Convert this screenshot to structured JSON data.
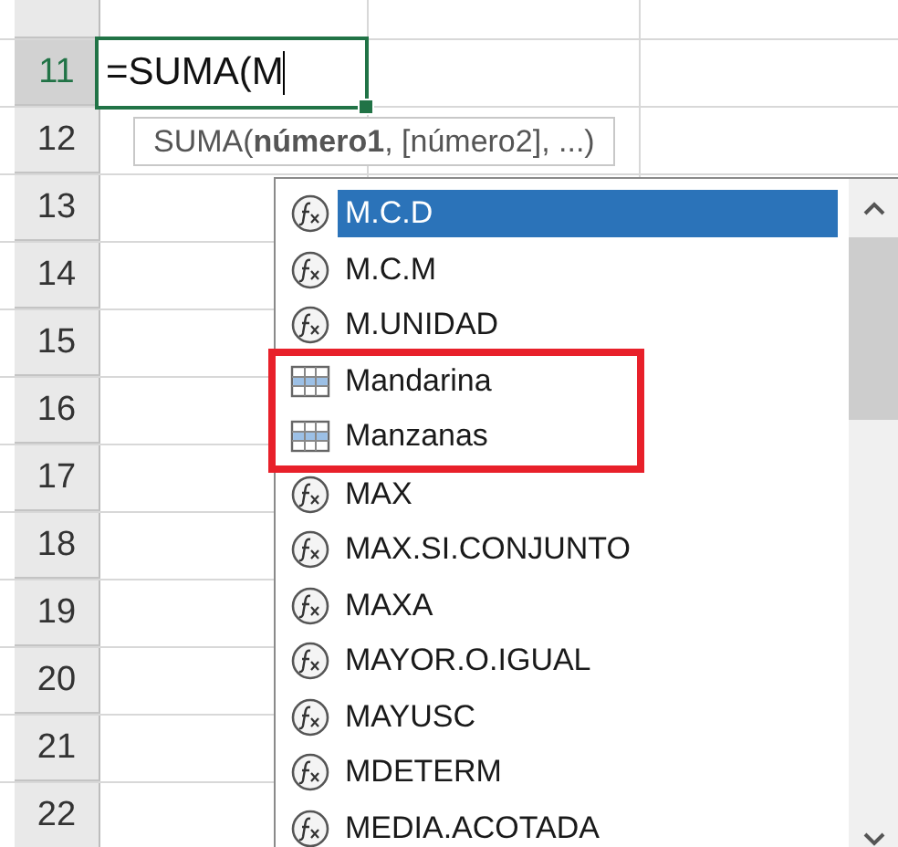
{
  "rows": [
    {
      "number": "11",
      "selected": true
    },
    {
      "number": "12",
      "selected": false
    },
    {
      "number": "13",
      "selected": false
    },
    {
      "number": "14",
      "selected": false
    },
    {
      "number": "15",
      "selected": false
    },
    {
      "number": "16",
      "selected": false
    },
    {
      "number": "17",
      "selected": false
    },
    {
      "number": "18",
      "selected": false
    },
    {
      "number": "19",
      "selected": false
    },
    {
      "number": "20",
      "selected": false
    },
    {
      "number": "21",
      "selected": false
    },
    {
      "number": "22",
      "selected": false
    }
  ],
  "active_cell": {
    "value": "=SUMA(M"
  },
  "tooltip": {
    "text": "SUMA(**número1**, [número2], ...)"
  },
  "autocomplete": {
    "items": [
      {
        "label": "M.C.D",
        "kind": "function",
        "selected": true,
        "marked": false
      },
      {
        "label": "M.C.M",
        "kind": "function",
        "selected": false,
        "marked": false
      },
      {
        "label": "M.UNIDAD",
        "kind": "function",
        "selected": false,
        "marked": false
      },
      {
        "label": "Mandarina",
        "kind": "table",
        "selected": false,
        "marked": true
      },
      {
        "label": "Manzanas",
        "kind": "table",
        "selected": false,
        "marked": true
      },
      {
        "label": "MAX",
        "kind": "function",
        "selected": false,
        "marked": false
      },
      {
        "label": "MAX.SI.CONJUNTO",
        "kind": "function",
        "selected": false,
        "marked": false
      },
      {
        "label": "MAXA",
        "kind": "function",
        "selected": false,
        "marked": false
      },
      {
        "label": "MAYOR.O.IGUAL",
        "kind": "function",
        "selected": false,
        "marked": false
      },
      {
        "label": "MAYUSC",
        "kind": "function",
        "selected": false,
        "marked": false
      },
      {
        "label": "MDETERM",
        "kind": "function",
        "selected": false,
        "marked": false
      },
      {
        "label": "MEDIA.ACOTADA",
        "kind": "function",
        "selected": false,
        "marked": false
      }
    ]
  }
}
